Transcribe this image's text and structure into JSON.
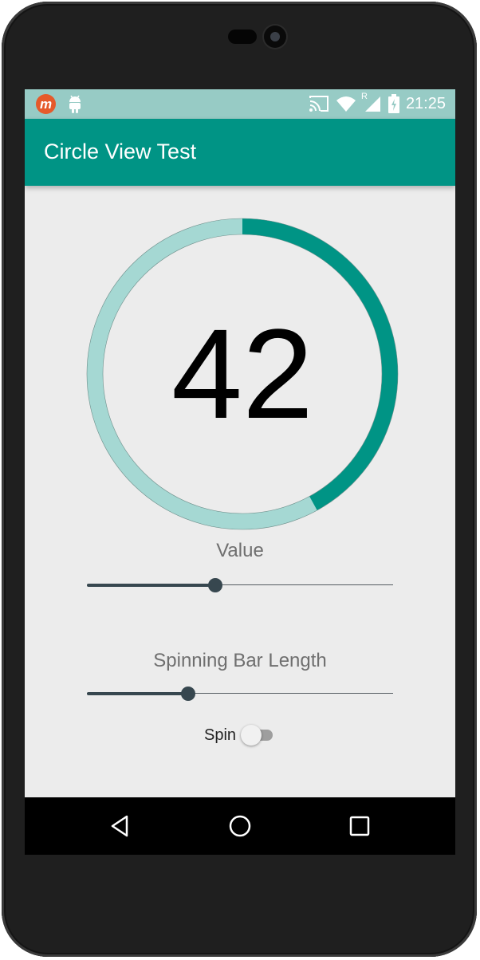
{
  "status_bar": {
    "time": "21:25",
    "left_icons": [
      "m-app-icon",
      "android-icon"
    ],
    "right_icons": [
      "cast-icon",
      "wifi-icon",
      "signal-icon",
      "battery-icon"
    ],
    "m_icon_letter": "m",
    "roaming_indicator": "R",
    "background_color": "#97cbc5"
  },
  "app_bar": {
    "title": "Circle View Test",
    "background_color": "#009485"
  },
  "circle_view": {
    "value": "42",
    "progress_fraction": 0.42,
    "bar_color": "#009485",
    "rim_color": "#a5d8d3"
  },
  "controls": {
    "value_label": "Value",
    "value_slider_fraction": 0.42,
    "spin_length_label": "Spinning Bar Length",
    "spin_length_slider_fraction": 0.33,
    "spin_label": "Spin",
    "spin_enabled": false,
    "accent_color": "#37474f"
  },
  "nav_bar": {
    "buttons": [
      "back-icon",
      "home-icon",
      "recents-icon"
    ]
  }
}
